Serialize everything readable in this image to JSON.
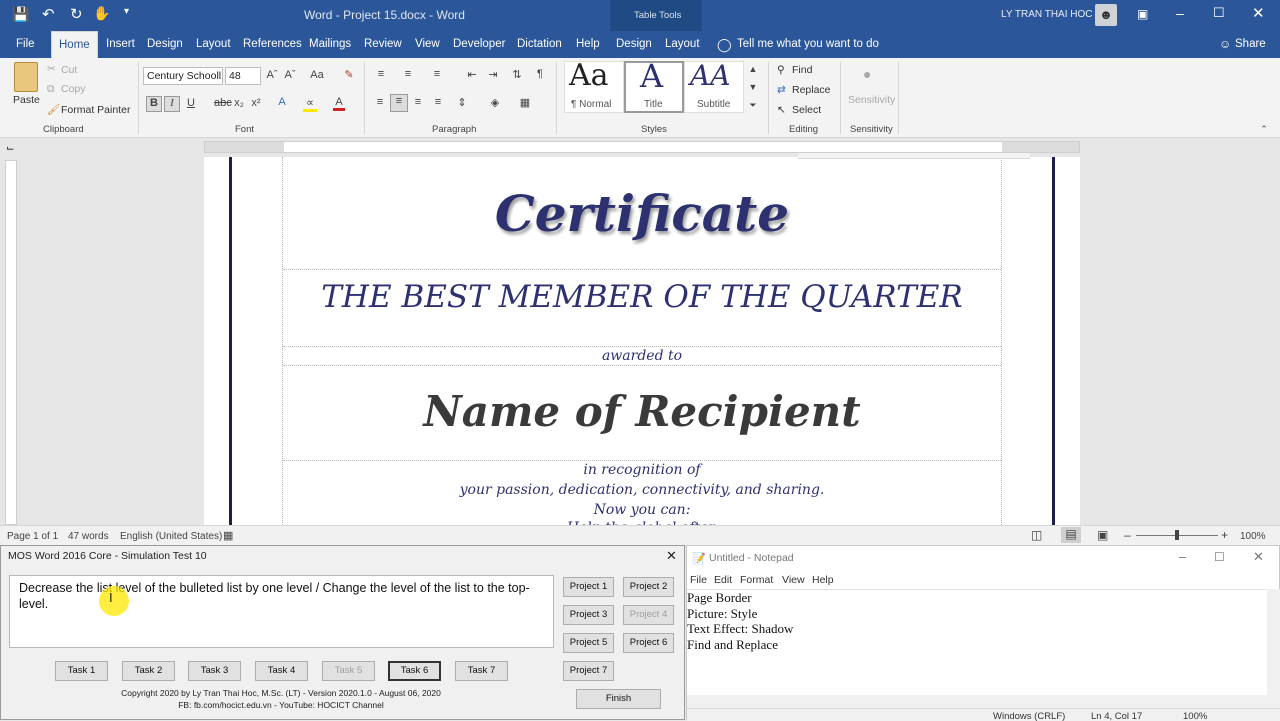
{
  "titlebar": {
    "doc_title": "Word - Project 15.docx - Word",
    "context_label": "Table Tools",
    "user": "LY TRAN THAI HOC"
  },
  "tabs": {
    "file": "File",
    "home": "Home",
    "insert": "Insert",
    "design": "Design",
    "layout": "Layout",
    "references": "References",
    "mailings": "Mailings",
    "review": "Review",
    "view": "View",
    "developer": "Developer",
    "dictation": "Dictation",
    "help": "Help",
    "table_design": "Design",
    "table_layout": "Layout",
    "tell_me": "Tell me what you want to do",
    "share": "Share"
  },
  "ribbon": {
    "clipboard": {
      "paste": "Paste",
      "cut": "Cut",
      "copy": "Copy",
      "format_painter": "Format Painter",
      "label": "Clipboard"
    },
    "font": {
      "font_name": "Century Schooll",
      "font_size": "48",
      "label": "Font"
    },
    "paragraph": {
      "label": "Paragraph"
    },
    "styles": {
      "normal": "¶ Normal",
      "title": "Title",
      "subtitle": "Subtitle",
      "sample_normal": "Aa",
      "sample_title": "A",
      "sample_subtitle": "AA",
      "label": "Styles"
    },
    "editing": {
      "find": "Find",
      "replace": "Replace",
      "select": "Select",
      "label": "Editing"
    },
    "sensitivity": {
      "button": "Sensitivity",
      "label": "Sensitivity"
    }
  },
  "document": {
    "title": "Certificate",
    "subtitle": "THE BEST MEMBER OF THE QUARTER",
    "awarded": "awarded to",
    "recipient": "Name of Recipient",
    "line1": "in recognition of",
    "line2": "your passion, dedication, connectivity, and sharing.",
    "line3": "Now you can:",
    "line4": "Help the global often"
  },
  "statusbar": {
    "page": "Page 1 of 1",
    "words": "47 words",
    "language": "English (United States)",
    "zoom": "100%"
  },
  "simulation": {
    "title": "MOS Word 2016 Core - Simulation Test 10",
    "task_text": "Decrease the list level of the bulleted list by one level / Change the level of the list to the top-level.",
    "projects": [
      "Project 1",
      "Project 2",
      "Project 3",
      "Project 4",
      "Project 5",
      "Project 6",
      "Project 7"
    ],
    "tasks": [
      "Task 1",
      "Task 2",
      "Task 3",
      "Task 4",
      "Task 5",
      "Task 6",
      "Task 7"
    ],
    "finish": "Finish",
    "copyright": "Copyright 2020 by Ly Tran Thai Hoc, M.Sc. (LT) - Version 2020.1.0 - August 06, 2020",
    "social": "FB: fb.com/hocict.edu.vn - YouTube: HOCICT Channel"
  },
  "notepad": {
    "title": "Untitled - Notepad",
    "menu": [
      "File",
      "Edit",
      "Format",
      "View",
      "Help"
    ],
    "lines": [
      "Page Border",
      "Picture: Style",
      "Text Effect: Shadow",
      "Find and Replace"
    ],
    "status_encoding": "Windows (CRLF)",
    "status_pos": "Ln 4, Col 17",
    "status_zoom": "100%"
  },
  "colors": {
    "word_blue": "#2b579a",
    "certificate_blue": "#2d3170",
    "recipient_gray": "#3a3a3a",
    "highlight_cursor": "#ffe800"
  }
}
